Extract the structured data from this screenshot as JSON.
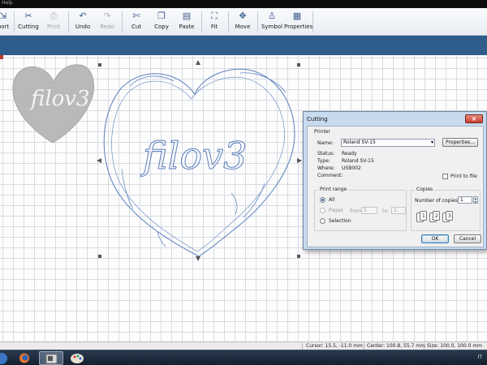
{
  "menu": {
    "help_fragment": "Help"
  },
  "toolbar": {
    "items": [
      {
        "key": "import",
        "label": "port",
        "icon": "import-icon",
        "enabled": true
      },
      {
        "key": "cutting",
        "label": "Cutting",
        "icon": "cutter-icon",
        "enabled": true
      },
      {
        "key": "print",
        "label": "Print",
        "icon": "printer-icon",
        "enabled": false
      },
      {
        "key": "undo",
        "label": "Undo",
        "icon": "undo-icon",
        "enabled": true
      },
      {
        "key": "redo",
        "label": "Redo",
        "icon": "redo-icon",
        "enabled": false
      },
      {
        "key": "cut",
        "label": "Cut",
        "icon": "scissors-icon",
        "enabled": true
      },
      {
        "key": "copy",
        "label": "Copy",
        "icon": "copy-icon",
        "enabled": true
      },
      {
        "key": "paste",
        "label": "Paste",
        "icon": "paste-icon",
        "enabled": true
      },
      {
        "key": "fit",
        "label": "Fit",
        "icon": "fit-icon",
        "enabled": true
      },
      {
        "key": "move",
        "label": "Move",
        "icon": "move-icon",
        "enabled": true
      },
      {
        "key": "symbol",
        "label": "Symbol",
        "icon": "symbol-icon",
        "enabled": true
      },
      {
        "key": "properties",
        "label": "Properties",
        "icon": "properties-icon",
        "enabled": true
      }
    ]
  },
  "canvas": {
    "artwork_text": "filov3"
  },
  "dialog": {
    "title": "Cutting",
    "close": "×",
    "printer_group": "Printer",
    "name_label": "Name:",
    "name_value": "Roland SV-15",
    "properties_button": "Properties...",
    "status_label": "Status:",
    "status_value": "Ready",
    "type_label": "Type:",
    "type_value": "Roland SV-15",
    "where_label": "Where:",
    "where_value": "USB002",
    "comment_label": "Comment:",
    "print_to_file": "Print to file",
    "print_range_group": "Print range",
    "all_option": "All",
    "pages_option": "Pages",
    "from_label": "from:",
    "from_value": "1",
    "to_label": "to:",
    "to_value": "1",
    "selection_option": "Selection",
    "copies_group": "Copies",
    "num_copies_label": "Number of copies:",
    "num_copies_value": "1",
    "collate_labels": [
      "1",
      "1",
      "2",
      "2",
      "3",
      "3"
    ],
    "ok_button": "OK",
    "cancel_button": "Cancel"
  },
  "statusbar": {
    "cursor": "Cursor: 15.5, -11.0 mm",
    "center": "Center: 100.8, 55.7 mm",
    "size": "Size: 100.0, 100.0 mm"
  },
  "taskbar": {
    "language": "IT"
  },
  "colors": {
    "band": "#2e5d8b",
    "canvas_grid": "#d7dbe2",
    "outline": "#5a7fbd",
    "dialog_frame": "#c8daee"
  }
}
